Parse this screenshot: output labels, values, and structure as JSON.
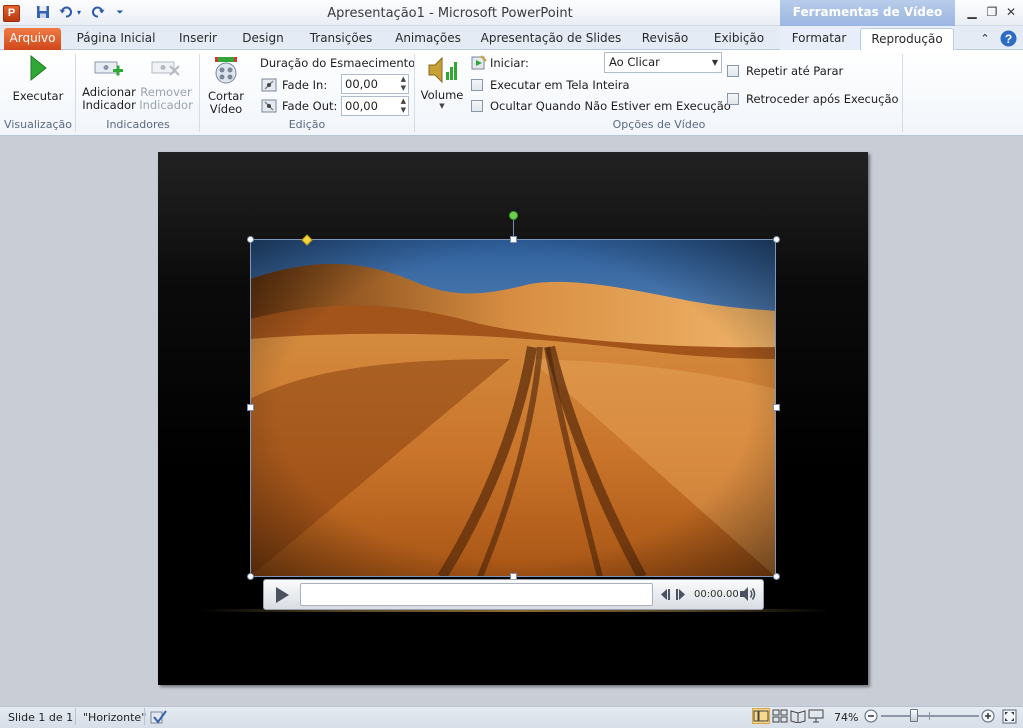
{
  "titlebar": {
    "app_icon_letter": "P",
    "title": "Apresentação1 - Microsoft PowerPoint",
    "contextual_header": "Ferramentas de Vídeo"
  },
  "tabs": {
    "file": "Arquivo",
    "home": "Página Inicial",
    "insert": "Inserir",
    "design": "Design",
    "transitions": "Transições",
    "animations": "Animações",
    "slideshow": "Apresentação de Slides",
    "review": "Revisão",
    "view": "Exibição",
    "format": "Formatar",
    "playback": "Reprodução"
  },
  "ribbon": {
    "preview": {
      "play_label": "Executar",
      "group_label": "Visualização"
    },
    "bookmarks": {
      "add_line1": "Adicionar",
      "add_line2": "Indicador",
      "remove_line1": "Remover",
      "remove_line2": "Indicador",
      "group_label": "Indicadores"
    },
    "editing": {
      "trim_line1": "Cortar",
      "trim_line2": "Vídeo",
      "fade_duration_title": "Duração do Esmaecimento",
      "fade_in_label": "Fade In:",
      "fade_in_value": "00,00",
      "fade_out_label": "Fade Out:",
      "fade_out_value": "00,00",
      "group_label": "Edição"
    },
    "video_options": {
      "volume_label": "Volume",
      "start_label": "Iniciar:",
      "start_value": "Ao Clicar",
      "fullscreen_label": "Executar em Tela Inteira",
      "hide_label": "Ocultar Quando Não Estiver em Execução",
      "loop_label": "Repetir até Parar",
      "rewind_label": "Retroceder após Execução",
      "group_label": "Opções de Vídeo"
    }
  },
  "player": {
    "time": "00:00.00"
  },
  "statusbar": {
    "slide_info": "Slide 1 de 1",
    "theme": "\"Horizonte\"",
    "zoom": "74%",
    "zoom_level_fraction": 0.5
  },
  "colors": {
    "file_tab": "#d0471a",
    "contextual": "#9bb6e2",
    "play_green": "#2fa836"
  }
}
